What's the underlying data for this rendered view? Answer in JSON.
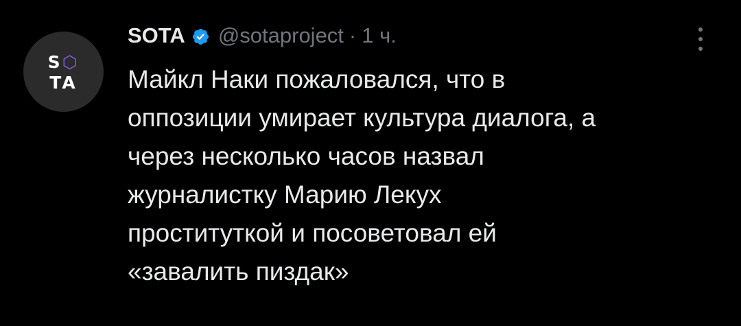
{
  "tweet": {
    "avatar": {
      "logo_top": [
        "S",
        "⬡"
      ],
      "logo_bottom": "TA"
    },
    "author": {
      "display_name": "SOTA",
      "handle": "@sotaproject",
      "separator": "·",
      "time": "1 ч."
    },
    "text_lines": [
      "Майкл Наки пожаловался, что в",
      "оппозиции умирает культура диалога, а",
      "через несколько часов назвал",
      "журналистку Марию Лекух",
      "проституткой и посоветовал ей",
      "«завалить пиздак»"
    ],
    "icons": {
      "verified": "verified-badge-icon",
      "more": "more-options-icon"
    },
    "colors": {
      "background": "#000000",
      "text_primary": "#e7e9ea",
      "text_secondary": "#71767b",
      "verified_blue": "#1d9bf0",
      "avatar_bg": "#2b2b2b",
      "logo_accent": "#8b5cf6"
    }
  }
}
